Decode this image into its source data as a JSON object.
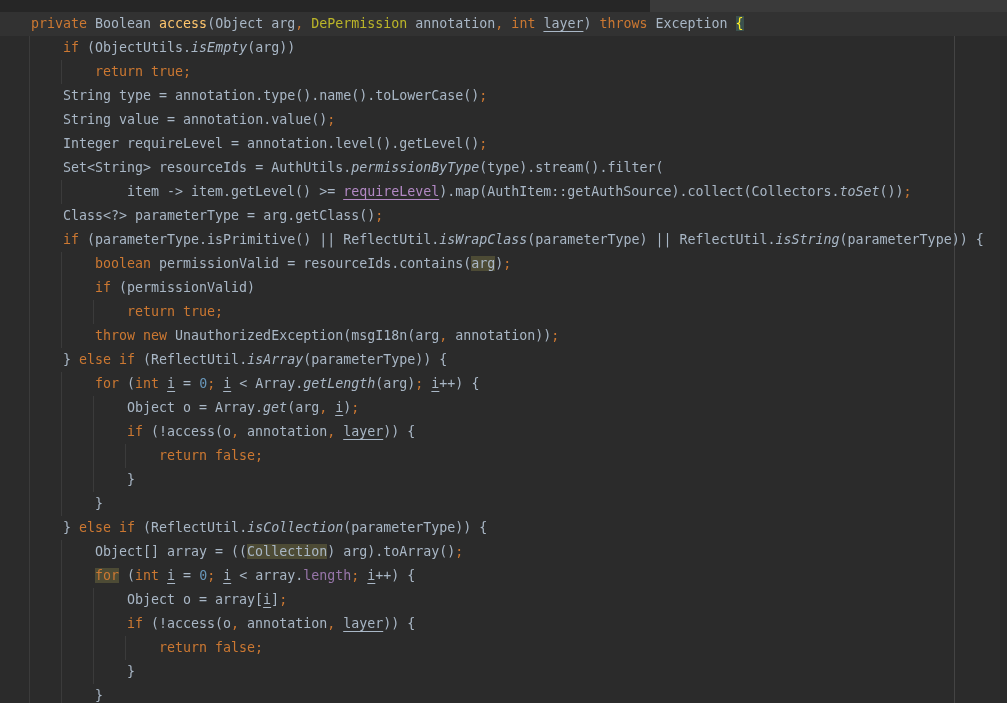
{
  "editor": {
    "lines": [
      {
        "current": true,
        "kind": "statement",
        "tokens": [
          {
            "kind": "keyword",
            "text": "private "
          },
          {
            "kind": "plain",
            "text": "Boolean "
          },
          {
            "kind": "declaration",
            "text": "access"
          },
          {
            "kind": "plain",
            "text": "(Object arg"
          },
          {
            "kind": "keyword",
            "text": ", "
          },
          {
            "kind": "annotation",
            "text": "DePermission"
          },
          {
            "kind": "plain",
            "text": " annotation"
          },
          {
            "kind": "keyword",
            "text": ", int "
          },
          {
            "kind": "reassigned",
            "text": "layer"
          },
          {
            "kind": "plain",
            "text": ") "
          },
          {
            "kind": "keyword",
            "text": "throws "
          },
          {
            "kind": "plain",
            "text": "Exception "
          },
          {
            "kind": "brace",
            "text": "{"
          }
        ],
        "children": [
          {
            "current": false,
            "kind": "statement",
            "tokens": [
              {
                "kind": "keyword",
                "text": "if "
              },
              {
                "kind": "plain",
                "text": "(ObjectUtils."
              },
              {
                "kind": "static",
                "text": "isEmpty"
              },
              {
                "kind": "plain",
                "text": "(arg))"
              }
            ],
            "children": [
              {
                "current": false,
                "kind": "statement",
                "tokens": [
                  {
                    "kind": "keyword",
                    "text": "return true;"
                  }
                ]
              }
            ]
          },
          {
            "current": false,
            "kind": "statement",
            "tokens": [
              {
                "kind": "plain",
                "text": "String type = annotation.type().name().toLowerCase()"
              },
              {
                "kind": "keyword",
                "text": ";"
              }
            ]
          },
          {
            "current": false,
            "kind": "statement",
            "tokens": [
              {
                "kind": "plain",
                "text": "String value = annotation.value()"
              },
              {
                "kind": "keyword",
                "text": ";"
              }
            ]
          },
          {
            "current": false,
            "kind": "statement",
            "tokens": [
              {
                "kind": "plain",
                "text": "Integer requireLevel = annotation.level().getLevel()"
              },
              {
                "kind": "keyword",
                "text": ";"
              }
            ]
          },
          {
            "current": false,
            "kind": "statement",
            "tokens": [
              {
                "kind": "plain",
                "text": "Set<String> resourceIds = AuthUtils."
              },
              {
                "kind": "static",
                "text": "permissionByType"
              },
              {
                "kind": "plain",
                "text": "(type).stream().filter("
              }
            ],
            "children": [
              {
                "current": false,
                "kind": "continuation",
                "tokens": [
                  {
                    "kind": "plain",
                    "text": "item -> item.getLevel() >= "
                  },
                  {
                    "kind": "captured",
                    "text": "requireLevel"
                  },
                  {
                    "kind": "plain",
                    "text": ").map(AuthItem::getAuthSource).collect(Collectors."
                  },
                  {
                    "kind": "static",
                    "text": "toSet"
                  },
                  {
                    "kind": "plain",
                    "text": "())"
                  },
                  {
                    "kind": "keyword",
                    "text": ";"
                  }
                ]
              }
            ]
          },
          {
            "current": false,
            "kind": "statement",
            "tokens": [
              {
                "kind": "plain",
                "text": "Class<?> parameterType = arg.getClass()"
              },
              {
                "kind": "keyword",
                "text": ";"
              }
            ]
          },
          {
            "current": false,
            "kind": "statement",
            "tokens": [
              {
                "kind": "keyword",
                "text": "if "
              },
              {
                "kind": "plain",
                "text": "(parameterType.isPrimitive() || ReflectUtil."
              },
              {
                "kind": "static",
                "text": "isWrapClass"
              },
              {
                "kind": "plain",
                "text": "(parameterType) || ReflectUtil."
              },
              {
                "kind": "static",
                "text": "isString"
              },
              {
                "kind": "plain",
                "text": "(parameterType)) {"
              }
            ],
            "children": [
              {
                "current": false,
                "kind": "statement",
                "tokens": [
                  {
                    "kind": "keyword",
                    "text": "boolean "
                  },
                  {
                    "kind": "plain",
                    "text": "permissionValid = resourceIds.contains("
                  },
                  {
                    "kind": "usage",
                    "text": "arg"
                  },
                  {
                    "kind": "plain",
                    "text": ")"
                  },
                  {
                    "kind": "keyword",
                    "text": ";"
                  }
                ]
              },
              {
                "current": false,
                "kind": "statement",
                "tokens": [
                  {
                    "kind": "keyword",
                    "text": "if "
                  },
                  {
                    "kind": "plain",
                    "text": "(permissionValid)"
                  }
                ],
                "children": [
                  {
                    "current": false,
                    "kind": "statement",
                    "tokens": [
                      {
                        "kind": "keyword",
                        "text": "return true;"
                      }
                    ]
                  }
                ]
              },
              {
                "current": false,
                "kind": "statement",
                "tokens": [
                  {
                    "kind": "keyword",
                    "text": "throw new "
                  },
                  {
                    "kind": "plain",
                    "text": "UnauthorizedException(msgI18n(arg"
                  },
                  {
                    "kind": "keyword",
                    "text": ", "
                  },
                  {
                    "kind": "plain",
                    "text": "annotation))"
                  },
                  {
                    "kind": "keyword",
                    "text": ";"
                  }
                ]
              }
            ]
          },
          {
            "current": false,
            "kind": "statement",
            "tokens": [
              {
                "kind": "plain",
                "text": "} "
              },
              {
                "kind": "keyword",
                "text": "else if "
              },
              {
                "kind": "plain",
                "text": "(ReflectUtil."
              },
              {
                "kind": "static",
                "text": "isArray"
              },
              {
                "kind": "plain",
                "text": "(parameterType)) {"
              }
            ],
            "children": [
              {
                "current": false,
                "kind": "statement",
                "tokens": [
                  {
                    "kind": "keyword",
                    "text": "for "
                  },
                  {
                    "kind": "plain",
                    "text": "("
                  },
                  {
                    "kind": "keyword",
                    "text": "int "
                  },
                  {
                    "kind": "reassigned",
                    "text": "i"
                  },
                  {
                    "kind": "plain",
                    "text": " = "
                  },
                  {
                    "kind": "number",
                    "text": "0"
                  },
                  {
                    "kind": "keyword",
                    "text": "; "
                  },
                  {
                    "kind": "reassigned",
                    "text": "i"
                  },
                  {
                    "kind": "plain",
                    "text": " < Array."
                  },
                  {
                    "kind": "static",
                    "text": "getLength"
                  },
                  {
                    "kind": "plain",
                    "text": "(arg)"
                  },
                  {
                    "kind": "keyword",
                    "text": "; "
                  },
                  {
                    "kind": "reassigned",
                    "text": "i"
                  },
                  {
                    "kind": "plain",
                    "text": "++) {"
                  }
                ],
                "children": [
                  {
                    "current": false,
                    "kind": "statement",
                    "tokens": [
                      {
                        "kind": "plain",
                        "text": "Object o = Array."
                      },
                      {
                        "kind": "static",
                        "text": "get"
                      },
                      {
                        "kind": "plain",
                        "text": "(arg"
                      },
                      {
                        "kind": "keyword",
                        "text": ", "
                      },
                      {
                        "kind": "reassigned",
                        "text": "i"
                      },
                      {
                        "kind": "plain",
                        "text": ")"
                      },
                      {
                        "kind": "keyword",
                        "text": ";"
                      }
                    ]
                  },
                  {
                    "current": false,
                    "kind": "statement",
                    "tokens": [
                      {
                        "kind": "keyword",
                        "text": "if "
                      },
                      {
                        "kind": "plain",
                        "text": "(!access(o"
                      },
                      {
                        "kind": "keyword",
                        "text": ", "
                      },
                      {
                        "kind": "plain",
                        "text": "annotation"
                      },
                      {
                        "kind": "keyword",
                        "text": ", "
                      },
                      {
                        "kind": "reassigned",
                        "text": "layer"
                      },
                      {
                        "kind": "plain",
                        "text": ")) {"
                      }
                    ],
                    "children": [
                      {
                        "current": false,
                        "kind": "statement",
                        "tokens": [
                          {
                            "kind": "keyword",
                            "text": "return false;"
                          }
                        ]
                      }
                    ]
                  },
                  {
                    "current": false,
                    "kind": "statement",
                    "tokens": [
                      {
                        "kind": "plain",
                        "text": "}"
                      }
                    ]
                  }
                ]
              },
              {
                "current": false,
                "kind": "statement",
                "tokens": [
                  {
                    "kind": "plain",
                    "text": "}"
                  }
                ]
              }
            ]
          },
          {
            "current": false,
            "kind": "statement",
            "tokens": [
              {
                "kind": "plain",
                "text": "} "
              },
              {
                "kind": "keyword",
                "text": "else if "
              },
              {
                "kind": "plain",
                "text": "(ReflectUtil."
              },
              {
                "kind": "static",
                "text": "isCollection"
              },
              {
                "kind": "plain",
                "text": "(parameterType)) {"
              }
            ],
            "children": [
              {
                "current": false,
                "kind": "statement",
                "tokens": [
                  {
                    "kind": "plain",
                    "text": "Object[] array = (("
                  },
                  {
                    "kind": "usage",
                    "text": "Collection"
                  },
                  {
                    "kind": "plain",
                    "text": ") arg).toArray()"
                  },
                  {
                    "kind": "keyword",
                    "text": ";"
                  }
                ]
              },
              {
                "current": false,
                "kind": "statement",
                "tokens": [
                  {
                    "kind": "marked",
                    "text": "for"
                  },
                  {
                    "kind": "plain",
                    "text": " ("
                  },
                  {
                    "kind": "keyword",
                    "text": "int "
                  },
                  {
                    "kind": "reassigned",
                    "text": "i"
                  },
                  {
                    "kind": "plain",
                    "text": " = "
                  },
                  {
                    "kind": "number",
                    "text": "0"
                  },
                  {
                    "kind": "keyword",
                    "text": "; "
                  },
                  {
                    "kind": "reassigned",
                    "text": "i"
                  },
                  {
                    "kind": "plain",
                    "text": " < array."
                  },
                  {
                    "kind": "field",
                    "text": "length"
                  },
                  {
                    "kind": "keyword",
                    "text": "; "
                  },
                  {
                    "kind": "reassigned",
                    "text": "i"
                  },
                  {
                    "kind": "plain",
                    "text": "++) {"
                  }
                ],
                "children": [
                  {
                    "current": false,
                    "kind": "statement",
                    "tokens": [
                      {
                        "kind": "plain",
                        "text": "Object o = array["
                      },
                      {
                        "kind": "reassigned",
                        "text": "i"
                      },
                      {
                        "kind": "plain",
                        "text": "]"
                      },
                      {
                        "kind": "keyword",
                        "text": ";"
                      }
                    ]
                  },
                  {
                    "current": false,
                    "kind": "statement",
                    "tokens": [
                      {
                        "kind": "keyword",
                        "text": "if "
                      },
                      {
                        "kind": "plain",
                        "text": "(!access(o"
                      },
                      {
                        "kind": "keyword",
                        "text": ", "
                      },
                      {
                        "kind": "plain",
                        "text": "annotation"
                      },
                      {
                        "kind": "keyword",
                        "text": ", "
                      },
                      {
                        "kind": "reassigned",
                        "text": "layer"
                      },
                      {
                        "kind": "plain",
                        "text": ")) {"
                      }
                    ],
                    "children": [
                      {
                        "current": false,
                        "kind": "statement",
                        "tokens": [
                          {
                            "kind": "keyword",
                            "text": "return false;"
                          }
                        ]
                      }
                    ]
                  },
                  {
                    "current": false,
                    "kind": "statement",
                    "tokens": [
                      {
                        "kind": "plain",
                        "text": "}"
                      }
                    ]
                  }
                ]
              },
              {
                "current": false,
                "kind": "statement",
                "tokens": [
                  {
                    "kind": "plain",
                    "text": "}"
                  }
                ]
              }
            ]
          }
        ]
      }
    ]
  }
}
